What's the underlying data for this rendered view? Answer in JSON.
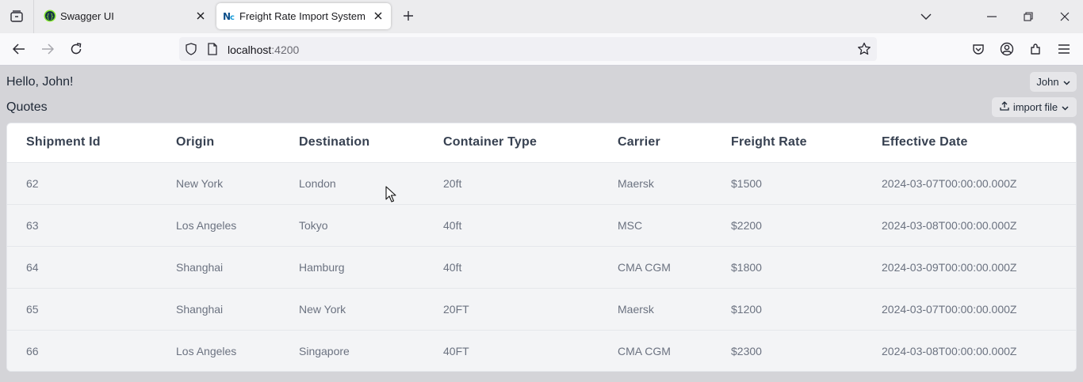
{
  "browser": {
    "tabs": [
      {
        "title": "Swagger UI",
        "icon": "swagger-icon",
        "active": false
      },
      {
        "title": "Freight Rate Import System",
        "icon": "nc-logo-icon",
        "active": true
      }
    ],
    "url": {
      "host": "localhost",
      "port": ":4200"
    }
  },
  "page": {
    "greeting": "Hello, John!",
    "section_title": "Quotes",
    "user_menu_label": "John",
    "import_button_label": "import file"
  },
  "table": {
    "columns": [
      "Shipment Id",
      "Origin",
      "Destination",
      "Container Type",
      "Carrier",
      "Freight Rate",
      "Effective Date"
    ],
    "rows": [
      [
        "62",
        "New York",
        "London",
        "20ft",
        "Maersk",
        "$1500",
        "2024-03-07T00:00:00.000Z"
      ],
      [
        "63",
        "Los Angeles",
        "Tokyo",
        "40ft",
        "MSC",
        "$2200",
        "2024-03-08T00:00:00.000Z"
      ],
      [
        "64",
        "Shanghai",
        "Hamburg",
        "40ft",
        "CMA CGM",
        "$1800",
        "2024-03-09T00:00:00.000Z"
      ],
      [
        "65",
        "Shanghai",
        "New York",
        "20FT",
        "Maersk",
        "$1200",
        "2024-03-07T00:00:00.000Z"
      ],
      [
        "66",
        "Los Angeles",
        "Singapore",
        "40FT",
        "CMA CGM",
        "$2300",
        "2024-03-08T00:00:00.000Z"
      ]
    ]
  },
  "colors": {
    "page_background": "#d4d4d8",
    "header_text": "#374151",
    "cell_text": "#6b7280",
    "row_background": "#f3f4f6"
  }
}
